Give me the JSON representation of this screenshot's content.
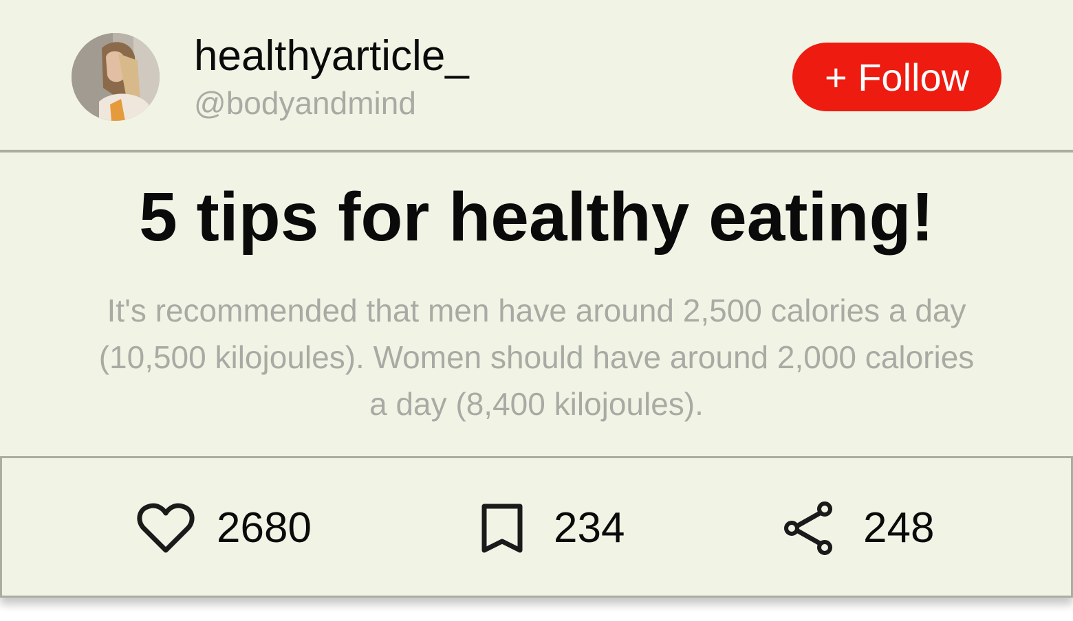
{
  "post": {
    "author": {
      "username": "healthyarticle_",
      "handle": "@bodyandmind"
    },
    "follow_label": "+ Follow",
    "title": "5 tips for healthy eating!",
    "description": "It's recommended that men have around 2,500 calories a day (10,500 kilojoules). Women should have around 2,000 calories a day (8,400 kilojoules).",
    "stats": {
      "likes": "2680",
      "saves": "234",
      "shares": "248"
    }
  },
  "icons": {
    "like": "heart-icon",
    "save": "bookmark-icon",
    "share": "share-icon"
  },
  "colors": {
    "card_background": "#f1f3e5",
    "follow_button": "#ee1b10",
    "divider": "#abada0",
    "muted_text": "#a8aba3",
    "primary_text": "#0a0a0a"
  }
}
